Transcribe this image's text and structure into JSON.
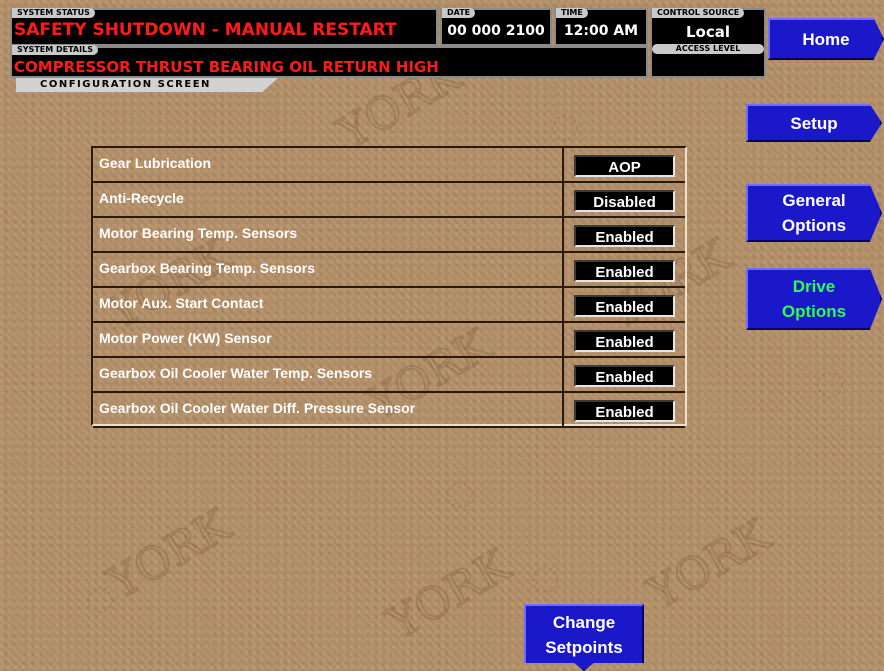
{
  "header": {
    "system_status_label": "SYSTEM STATUS",
    "system_status": "SAFETY SHUTDOWN - MANUAL RESTART",
    "system_details_label": "SYSTEM DETAILS",
    "system_details": "COMPRESSOR THRUST BEARING OIL RETURN HIGH",
    "date_label": "DATE",
    "date": "00 000 2100",
    "time_label": "TIME",
    "time": "12:00 AM",
    "control_source_label": "CONTROL SOURCE",
    "control_source": "Local",
    "access_level_label": "ACCESS LEVEL",
    "access_level": ""
  },
  "screen_title": "CONFIGURATION SCREEN",
  "nav": {
    "home": "Home",
    "setup": "Setup",
    "general_options_l1": "General",
    "general_options_l2": "Options",
    "drive_options_l1": "Drive",
    "drive_options_l2": "Options",
    "change_setpoints_l1": "Change",
    "change_setpoints_l2": "Setpoints"
  },
  "config": [
    {
      "label": "Gear Lubrication",
      "value": "AOP"
    },
    {
      "label": "Anti-Recycle",
      "value": "Disabled"
    },
    {
      "label": "Motor Bearing Temp. Sensors",
      "value": "Enabled"
    },
    {
      "label": "Gearbox Bearing Temp. Sensors",
      "value": "Enabled"
    },
    {
      "label": "Motor Aux. Start Contact",
      "value": "Enabled"
    },
    {
      "label": "Motor Power (KW) Sensor",
      "value": "Enabled"
    },
    {
      "label": "Gearbox Oil Cooler Water Temp. Sensors",
      "value": "Enabled"
    },
    {
      "label": "Gearbox Oil Cooler Water Diff. Pressure Sensor",
      "value": "Enabled"
    }
  ],
  "colors": {
    "background": "#b48f67",
    "status_red": "#ff1a1a",
    "button_blue": "#1a18c8",
    "active_green": "#2bff4b"
  }
}
